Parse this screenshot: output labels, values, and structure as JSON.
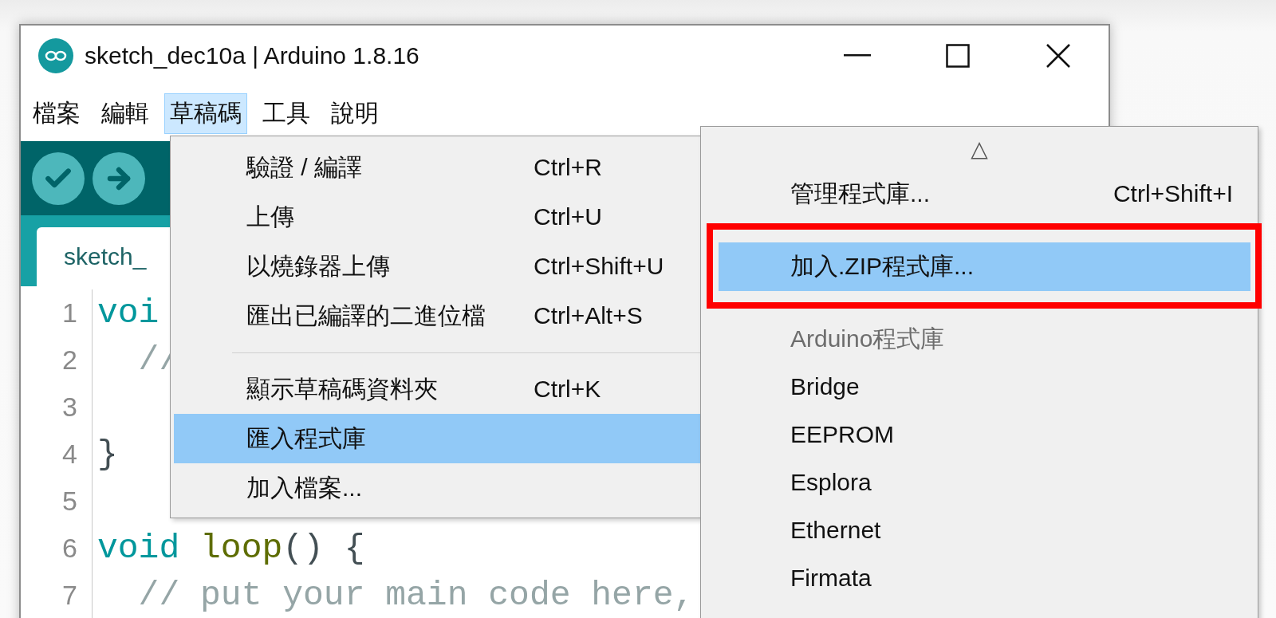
{
  "window": {
    "title": "sketch_dec10a | Arduino 1.8.16"
  },
  "menubar": [
    {
      "label": "檔案",
      "selected": false
    },
    {
      "label": "編輯",
      "selected": false
    },
    {
      "label": "草稿碼",
      "selected": true
    },
    {
      "label": "工具",
      "selected": false
    },
    {
      "label": "說明",
      "selected": false
    }
  ],
  "toolbar": {
    "buttons": [
      {
        "kind": "verify"
      },
      {
        "kind": "upload"
      }
    ]
  },
  "tabs": [
    {
      "label": "sketch_"
    }
  ],
  "editor": {
    "lines": [
      {
        "number": "1",
        "segments": [
          {
            "kind": "keyword",
            "text": "voi"
          }
        ]
      },
      {
        "number": "2",
        "segments": [
          {
            "kind": "comment",
            "text": "  //"
          }
        ]
      },
      {
        "number": "3"
      },
      {
        "number": "4",
        "segments": [
          {
            "kind": "plain",
            "text": "}"
          }
        ]
      },
      {
        "number": "5"
      },
      {
        "number": "6",
        "segments": [
          {
            "kind": "keyword",
            "text": "void "
          },
          {
            "kind": "function",
            "text": "loop"
          },
          {
            "kind": "plain",
            "text": "() {"
          }
        ]
      },
      {
        "number": "7",
        "segments": [
          {
            "kind": "comment",
            "text": "  // put your main code here, "
          }
        ]
      }
    ]
  },
  "sketch_menu": {
    "items": [
      {
        "kind": "item",
        "label": "驗證 / 編譯",
        "shortcut": "Ctrl+R",
        "selected": false
      },
      {
        "kind": "item",
        "label": "上傳",
        "shortcut": "Ctrl+U",
        "selected": false
      },
      {
        "kind": "item",
        "label": "以燒錄器上傳",
        "shortcut": "Ctrl+Shift+U",
        "selected": false
      },
      {
        "kind": "item",
        "label": "匯出已編譯的二進位檔",
        "shortcut": "Ctrl+Alt+S",
        "selected": false
      },
      {
        "kind": "separator"
      },
      {
        "kind": "item",
        "label": "顯示草稿碼資料夾",
        "shortcut": "Ctrl+K",
        "selected": false
      },
      {
        "kind": "item",
        "label": "匯入程式庫",
        "selected": true
      },
      {
        "kind": "item",
        "label": "加入檔案...",
        "selected": false
      }
    ]
  },
  "library_submenu": {
    "scroll_indicator": "△",
    "items": [
      {
        "kind": "item",
        "label": "管理程式庫...",
        "shortcut": "Ctrl+Shift+I",
        "selected": false,
        "annotated": false
      },
      {
        "kind": "item",
        "label": "加入.ZIP程式庫...",
        "selected": true,
        "annotated": true
      },
      {
        "kind": "header",
        "label": "Arduino程式庫"
      },
      {
        "kind": "item",
        "label": "Bridge",
        "selected": false,
        "annotated": false
      },
      {
        "kind": "item",
        "label": "EEPROM",
        "selected": false,
        "annotated": false
      },
      {
        "kind": "item",
        "label": "Esplora",
        "selected": false,
        "annotated": false
      },
      {
        "kind": "item",
        "label": "Ethernet",
        "selected": false,
        "annotated": false
      },
      {
        "kind": "item",
        "label": "Firmata",
        "selected": false,
        "annotated": false
      }
    ]
  }
}
